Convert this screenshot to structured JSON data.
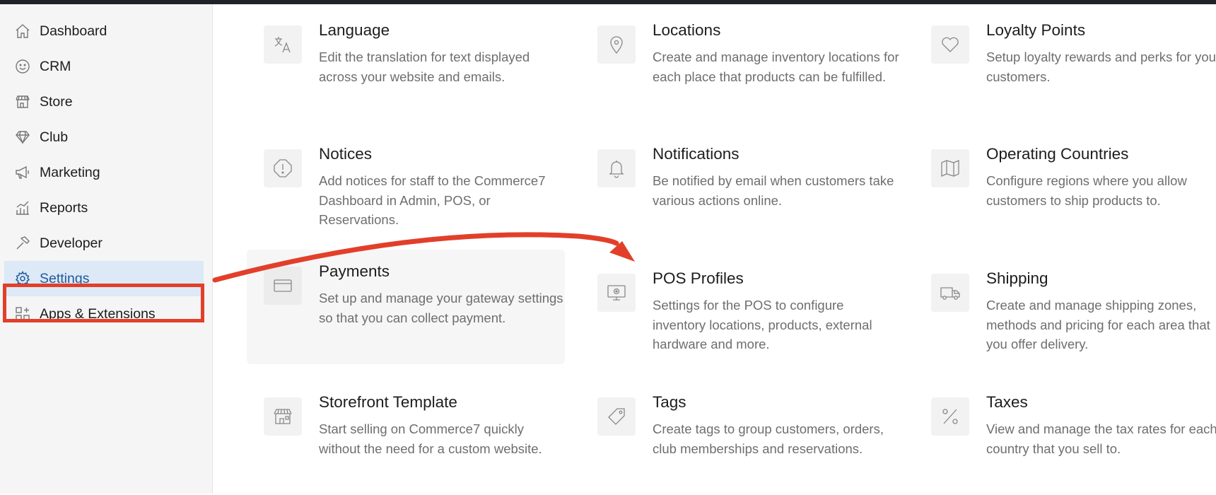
{
  "sidebar": {
    "items": [
      {
        "label": "Dashboard",
        "icon": "home-icon"
      },
      {
        "label": "CRM",
        "icon": "smiley-icon"
      },
      {
        "label": "Store",
        "icon": "storefront-icon"
      },
      {
        "label": "Club",
        "icon": "diamond-icon"
      },
      {
        "label": "Marketing",
        "icon": "megaphone-icon"
      },
      {
        "label": "Reports",
        "icon": "chart-icon"
      },
      {
        "label": "Developer",
        "icon": "hammer-icon"
      },
      {
        "label": "Settings",
        "icon": "gear-icon",
        "active": true
      },
      {
        "label": "Apps & Extensions",
        "icon": "apps-icon"
      }
    ]
  },
  "cards": [
    {
      "title": "Language",
      "desc": "Edit the translation for text displayed across your website and emails.",
      "icon": "translate-icon"
    },
    {
      "title": "Locations",
      "desc": "Create and manage inventory locations for each place that products can be fulfilled.",
      "icon": "map-pin-icon"
    },
    {
      "title": "Loyalty Points",
      "desc": "Setup loyalty rewards and perks for your customers.",
      "icon": "heart-icon"
    },
    {
      "title": "Notices",
      "desc": "Add notices for staff to the Commerce7 Dashboard in Admin, POS, or Reservations.",
      "icon": "alert-icon"
    },
    {
      "title": "Notifications",
      "desc": "Be notified by email when customers take various actions online.",
      "icon": "bell-icon"
    },
    {
      "title": "Operating Countries",
      "desc": "Configure regions where you allow customers to ship products to.",
      "icon": "map-icon"
    },
    {
      "title": "Payments",
      "desc": "Set up and manage your gateway settings so that you can collect payment.",
      "icon": "credit-card-icon"
    },
    {
      "title": "POS Profiles",
      "desc": "Settings for the POS to configure inventory locations, products, external hardware and more.",
      "icon": "monitor-icon"
    },
    {
      "title": "Shipping",
      "desc": "Create and manage shipping zones, methods and pricing for each area that you offer delivery.",
      "icon": "truck-icon"
    },
    {
      "title": "Storefront Template",
      "desc": "Start selling on Commerce7 quickly without the need for a custom website.",
      "icon": "storefront-icon"
    },
    {
      "title": "Tags",
      "desc": "Create tags to group customers, orders, club memberships and reservations.",
      "icon": "tag-icon"
    },
    {
      "title": "Taxes",
      "desc": "View and manage the tax rates for each country that you sell to.",
      "icon": "percent-icon"
    }
  ],
  "colors": {
    "annotation": "#e23f2a",
    "active_bg": "#dde9f6",
    "active_text": "#1c5a9c"
  }
}
